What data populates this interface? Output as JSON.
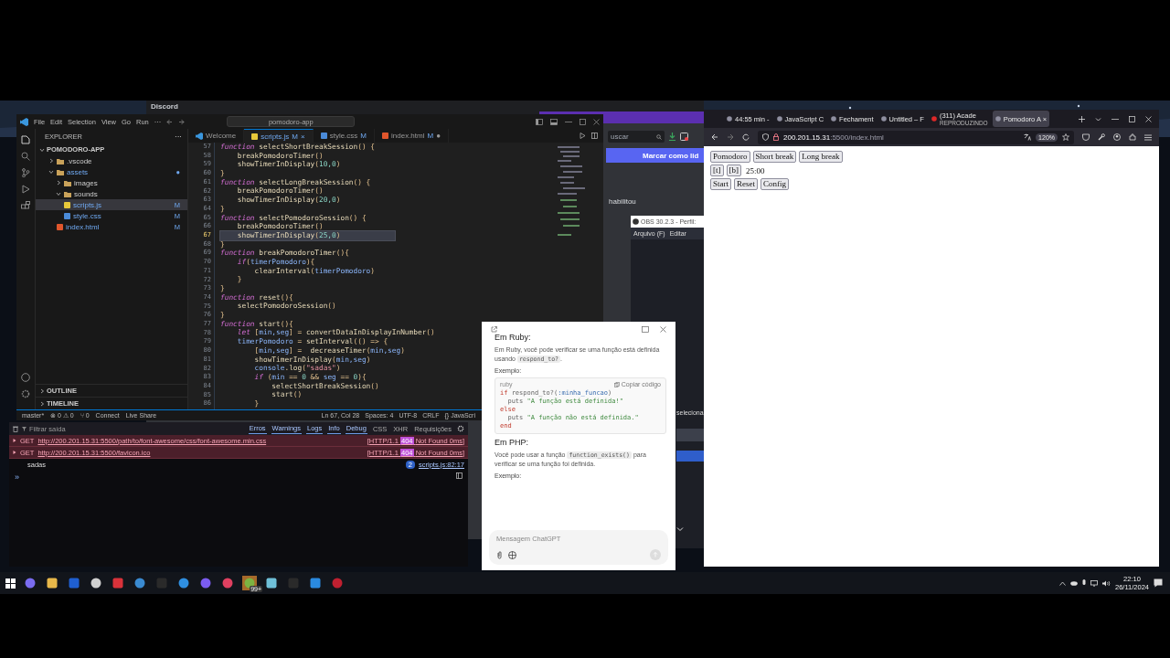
{
  "discord": {
    "title": "Discord",
    "search": {
      "placeholder": "uscar"
    },
    "mark_read": "Marcar como lid",
    "message": "habilitou"
  },
  "obs": {
    "title": "OBS 30.2.3 - Perfil:",
    "menu": [
      "Arquivo (F)",
      "Editar"
    ],
    "label": "seleciona"
  },
  "vscode": {
    "menu": [
      "File",
      "Edit",
      "Selection",
      "View",
      "Go",
      "Run",
      "···"
    ],
    "command_center": "pomodoro-app",
    "explorer": {
      "title": "EXPLORER",
      "more": "···",
      "project": "POMODORO-APP",
      "tree": [
        {
          "label": ".vscode",
          "kind": "folder",
          "expanded": false,
          "selected": false
        },
        {
          "label": "assets",
          "kind": "folder",
          "expanded": true,
          "selected": false,
          "badge": "●",
          "children": [
            {
              "label": "images",
              "kind": "folder",
              "expanded": false,
              "selected": false
            },
            {
              "label": "sounds",
              "kind": "folder",
              "expanded": true,
              "selected": false
            },
            {
              "label": "scripts.js",
              "kind": "js",
              "selected": true,
              "badge": "M"
            },
            {
              "label": "style.css",
              "kind": "css",
              "selected": false,
              "badge": "M"
            }
          ]
        },
        {
          "label": "index.html",
          "kind": "html",
          "selected": false,
          "badge": "M"
        }
      ],
      "sections": [
        "OUTLINE",
        "TIMELINE"
      ]
    },
    "tabs": [
      {
        "label": "Welcome",
        "kind": "welcome",
        "selected": false
      },
      {
        "label": "scripts.js",
        "kind": "js",
        "badge": "M",
        "close": "×",
        "selected": true
      },
      {
        "label": "style.css",
        "kind": "css",
        "badge": "M",
        "selected": false
      },
      {
        "label": "index.html",
        "kind": "html",
        "badge": "M",
        "dot": "●",
        "selected": false
      }
    ],
    "code": [
      {
        "number": "57",
        "current": false,
        "tokens": [
          {
            "kind": "keyword",
            "text": "function"
          },
          {
            "kind": "name",
            "text": " selectShortBreakSession"
          },
          {
            "kind": "punct",
            "text": "() {"
          }
        ]
      },
      {
        "number": "58",
        "current": false,
        "tokens": [
          {
            "kind": "name",
            "text": "    breakPomodoroTimer"
          },
          {
            "kind": "punct",
            "text": "()"
          }
        ]
      },
      {
        "number": "59",
        "current": false,
        "tokens": [
          {
            "kind": "name",
            "text": "    showTimerInDisplay"
          },
          {
            "kind": "punct",
            "text": "("
          },
          {
            "kind": "number",
            "text": "10,0"
          },
          {
            "kind": "punct",
            "text": ")"
          }
        ]
      },
      {
        "number": "60",
        "current": false,
        "tokens": [
          {
            "kind": "punct",
            "text": "}"
          }
        ]
      },
      {
        "number": "61",
        "current": false,
        "tokens": [
          {
            "kind": "keyword",
            "text": "function"
          },
          {
            "kind": "name",
            "text": " selectLongBreakSession"
          },
          {
            "kind": "punct",
            "text": "() {"
          }
        ]
      },
      {
        "number": "62",
        "current": false,
        "tokens": [
          {
            "kind": "name",
            "text": "    breakPomodoroTimer"
          },
          {
            "kind": "punct",
            "text": "()"
          }
        ]
      },
      {
        "number": "63",
        "current": false,
        "tokens": [
          {
            "kind": "name",
            "text": "    showTimerInDisplay"
          },
          {
            "kind": "punct",
            "text": "("
          },
          {
            "kind": "number",
            "text": "20,0"
          },
          {
            "kind": "punct",
            "text": ")"
          }
        ]
      },
      {
        "number": "64",
        "current": false,
        "tokens": [
          {
            "kind": "punct",
            "text": "}"
          }
        ]
      },
      {
        "number": "65",
        "current": false,
        "tokens": [
          {
            "kind": "keyword",
            "text": "function"
          },
          {
            "kind": "name",
            "text": " selectPomodoroSession"
          },
          {
            "kind": "punct",
            "text": "() {"
          }
        ]
      },
      {
        "number": "66",
        "current": false,
        "tokens": [
          {
            "kind": "name",
            "text": "    breakPomodoroTimer"
          },
          {
            "kind": "punct",
            "text": "()"
          }
        ]
      },
      {
        "number": "67",
        "current": true,
        "tokens": [
          {
            "kind": "name",
            "text": "    showTimerInDisplay"
          },
          {
            "kind": "punct",
            "text": "("
          },
          {
            "kind": "number",
            "text": "25,0"
          },
          {
            "kind": "punct",
            "text": ")"
          }
        ]
      },
      {
        "number": "68",
        "current": false,
        "tokens": [
          {
            "kind": "punct",
            "text": "}"
          }
        ]
      },
      {
        "number": "69",
        "current": false,
        "tokens": [
          {
            "kind": "keyword",
            "text": "function"
          },
          {
            "kind": "name",
            "text": " breakPomodoroTimer"
          },
          {
            "kind": "punct",
            "text": "(){"
          }
        ]
      },
      {
        "number": "70",
        "current": false,
        "tokens": [
          {
            "kind": "keyword",
            "text": "    if"
          },
          {
            "kind": "punct",
            "text": "("
          },
          {
            "kind": "param",
            "text": "timerPomodoro"
          },
          {
            "kind": "punct",
            "text": "){"
          }
        ]
      },
      {
        "number": "71",
        "current": false,
        "tokens": [
          {
            "kind": "name",
            "text": "        clearInterval"
          },
          {
            "kind": "punct",
            "text": "("
          },
          {
            "kind": "param",
            "text": "timerPomodoro"
          },
          {
            "kind": "punct",
            "text": ")"
          }
        ]
      },
      {
        "number": "72",
        "current": false,
        "tokens": [
          {
            "kind": "punct",
            "text": "    }"
          }
        ]
      },
      {
        "number": "73",
        "current": false,
        "tokens": [
          {
            "kind": "punct",
            "text": "}"
          }
        ]
      },
      {
        "number": "74",
        "current": false,
        "tokens": [
          {
            "kind": "keyword",
            "text": "function"
          },
          {
            "kind": "name",
            "text": " reset"
          },
          {
            "kind": "punct",
            "text": "(){"
          }
        ]
      },
      {
        "number": "75",
        "current": false,
        "tokens": [
          {
            "kind": "name",
            "text": "    selectPomodoroSession"
          },
          {
            "kind": "punct",
            "text": "()"
          }
        ]
      },
      {
        "number": "76",
        "current": false,
        "tokens": [
          {
            "kind": "punct",
            "text": "}"
          }
        ]
      },
      {
        "number": "77",
        "current": false,
        "tokens": [
          {
            "kind": "keyword",
            "text": "function"
          },
          {
            "kind": "name",
            "text": " start"
          },
          {
            "kind": "punct",
            "text": "(){"
          }
        ]
      },
      {
        "number": "78",
        "current": false,
        "tokens": [
          {
            "kind": "keyword",
            "text": "    let"
          },
          {
            "kind": "punct",
            "text": " ["
          },
          {
            "kind": "param",
            "text": "min,seg"
          },
          {
            "kind": "punct",
            "text": "] = "
          },
          {
            "kind": "name",
            "text": "convertDataInDisplayInNumber"
          },
          {
            "kind": "punct",
            "text": "()"
          }
        ]
      },
      {
        "number": "79",
        "current": false,
        "tokens": [
          {
            "kind": "param",
            "text": "    timerPomodoro"
          },
          {
            "kind": "punct",
            "text": " = "
          },
          {
            "kind": "name",
            "text": "setInterval"
          },
          {
            "kind": "punct",
            "text": "(() => {"
          }
        ]
      },
      {
        "number": "80",
        "current": false,
        "tokens": [
          {
            "kind": "punct",
            "text": "        ["
          },
          {
            "kind": "param",
            "text": "min,seg"
          },
          {
            "kind": "punct",
            "text": "] =  "
          },
          {
            "kind": "name",
            "text": "decreaseTimer"
          },
          {
            "kind": "punct",
            "text": "("
          },
          {
            "kind": "param",
            "text": "min,seg"
          },
          {
            "kind": "punct",
            "text": ")"
          }
        ]
      },
      {
        "number": "81",
        "current": false,
        "tokens": [
          {
            "kind": "name",
            "text": "        showTimerInDisplay"
          },
          {
            "kind": "punct",
            "text": "("
          },
          {
            "kind": "param",
            "text": "min,seg"
          },
          {
            "kind": "punct",
            "text": ")"
          }
        ]
      },
      {
        "number": "82",
        "current": false,
        "tokens": [
          {
            "kind": "param",
            "text": "        console"
          },
          {
            "kind": "punct",
            "text": "."
          },
          {
            "kind": "name",
            "text": "log"
          },
          {
            "kind": "punct",
            "text": "("
          },
          {
            "kind": "string",
            "text": "\"sadas\""
          },
          {
            "kind": "punct",
            "text": ")"
          }
        ]
      },
      {
        "number": "83",
        "current": false,
        "tokens": [
          {
            "kind": "keyword",
            "text": "        if"
          },
          {
            "kind": "punct",
            "text": " ("
          },
          {
            "kind": "param",
            "text": "min"
          },
          {
            "kind": "punct",
            "text": " == "
          },
          {
            "kind": "number",
            "text": "0"
          },
          {
            "kind": "punct",
            "text": " && "
          },
          {
            "kind": "param",
            "text": "seg"
          },
          {
            "kind": "punct",
            "text": " == "
          },
          {
            "kind": "number",
            "text": "0"
          },
          {
            "kind": "punct",
            "text": "){"
          }
        ]
      },
      {
        "number": "84",
        "current": false,
        "tokens": [
          {
            "kind": "name",
            "text": "            selectShortBreakSession"
          },
          {
            "kind": "punct",
            "text": "()"
          }
        ]
      },
      {
        "number": "85",
        "current": false,
        "tokens": [
          {
            "kind": "name",
            "text": "            start"
          },
          {
            "kind": "punct",
            "text": "()"
          }
        ]
      },
      {
        "number": "86",
        "current": false,
        "tokens": [
          {
            "kind": "punct",
            "text": "        }"
          }
        ]
      }
    ],
    "status_bar": {
      "left": [
        "master*",
        "⊗ 0 ⚠ 0",
        "⑂ 0",
        "Connect",
        "Live Share"
      ],
      "right": [
        "Ln 67, Col 28",
        "Spaces: 4",
        "UTF-8",
        "CRLF",
        "{} JavaScri"
      ]
    }
  },
  "console": {
    "filter": {
      "placeholder": "Filtrar saída"
    },
    "levels": [
      {
        "label": "Erros",
        "selected": true
      },
      {
        "label": "Warnings",
        "selected": true
      },
      {
        "label": "Logs",
        "selected": true
      },
      {
        "label": "Info",
        "selected": true
      },
      {
        "label": "Debug",
        "selected": true
      },
      {
        "label": "CSS",
        "selected": false
      },
      {
        "label": "XHR",
        "selected": false
      },
      {
        "label": "Requisições",
        "selected": false
      }
    ],
    "messages": [
      {
        "kind": "error",
        "method": "GET",
        "url": "http://200.201.15.31:5500/path/to/font-awesome/css/font-awesome.min.css",
        "protocol": "[HTTP/1.1",
        "code": "404",
        "reason": "Not Found 0ms]"
      },
      {
        "kind": "error",
        "method": "GET",
        "url": "http://200.201.15.31:5500/favicon.ico",
        "protocol": "[HTTP/1.1",
        "code": "404",
        "reason": "Not Found 0ms]"
      },
      {
        "kind": "log",
        "text": "sadas",
        "count": "2",
        "source": "scripts.js:82:17"
      }
    ],
    "prompt": "»"
  },
  "firefox": {
    "tabs": [
      {
        "label": "44:55 min -",
        "selected": false
      },
      {
        "label": "JavaScript C",
        "selected": false
      },
      {
        "label": "Fechament",
        "selected": false
      },
      {
        "label": "Untitled – F",
        "selected": false
      },
      {
        "label": "(311) Acade",
        "sublabel": "REPRODUZINDO",
        "selected": false
      },
      {
        "label": "Pomodoro A",
        "close": "×",
        "selected": true
      }
    ],
    "url": {
      "host": "200.201.15.31",
      "rest": ":5500/index.html"
    },
    "zoom": "120%",
    "page": {
      "session_buttons": [
        "Pomodoro",
        "Short break",
        "Long break"
      ],
      "toggles": [
        "[t]",
        "[b]"
      ],
      "timer": "25:00",
      "controls": [
        "Start",
        "Reset",
        "Config"
      ]
    }
  },
  "chat": {
    "sections": [
      {
        "heading": "Em Ruby:",
        "text": {
          "before": "Em Ruby, você pode verificar se uma função está definida usando ",
          "code": "respond_to?",
          "after": "."
        },
        "example": "Exemplo:",
        "code_block": {
          "language": "ruby",
          "copy": "Copiar código",
          "lines": [
            [
              {
                "kind": "keyword",
                "text": "if"
              },
              {
                "kind": "plain",
                "text": " respond_to?("
              },
              {
                "kind": "param",
                "text": ":minha_funcao"
              },
              {
                "kind": "plain",
                "text": ")"
              }
            ],
            [
              {
                "kind": "plain",
                "text": "  puts "
              },
              {
                "kind": "string",
                "text": "\"A função está definida!\""
              }
            ],
            [
              {
                "kind": "keyword",
                "text": "else"
              }
            ],
            [
              {
                "kind": "plain",
                "text": "  puts "
              },
              {
                "kind": "string",
                "text": "\"A função não está definida.\""
              }
            ],
            [
              {
                "kind": "keyword",
                "text": "end"
              }
            ]
          ]
        }
      },
      {
        "heading": "Em PHP:",
        "text": {
          "before": "Você pode usar a função ",
          "code": "function_exists()",
          "after": " para verificar se uma função foi definida."
        },
        "example": "Exemplo:"
      }
    ],
    "input": {
      "placeholder": "Mensagem ChatGPT"
    }
  },
  "taskbar": {
    "badge": "99+",
    "time": "22:10",
    "date": "26/11/2024"
  }
}
